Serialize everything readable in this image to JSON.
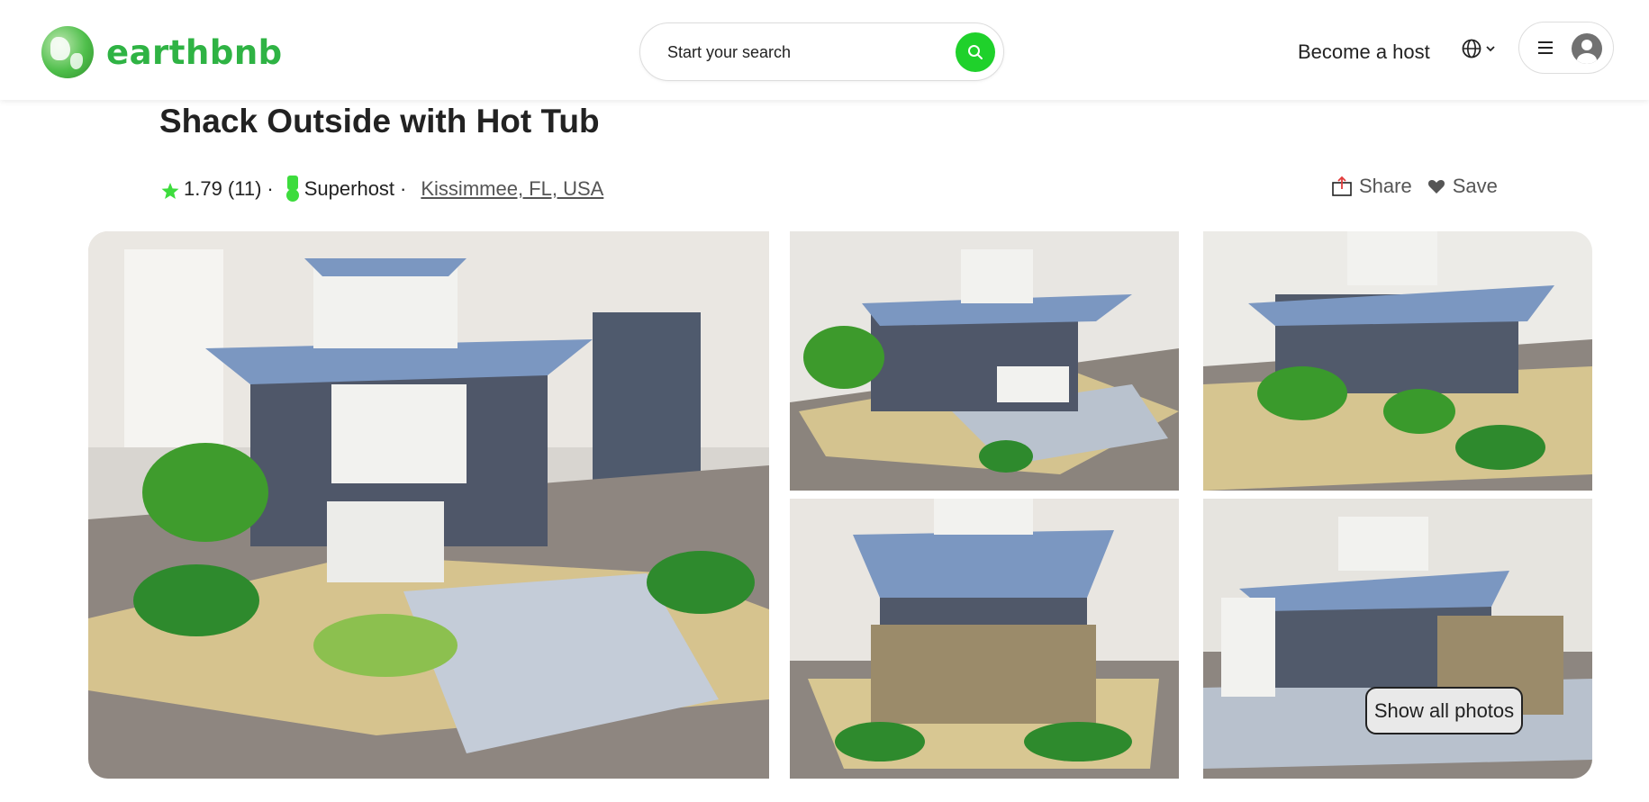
{
  "header": {
    "logo_text": "earthbnb",
    "search_placeholder": "Start your search",
    "become_host": "Become a host",
    "globe_icon": "globe-icon",
    "menu_icon": "hamburger-menu-icon",
    "avatar_icon": "user-avatar-icon"
  },
  "listing": {
    "title": "Shack Outside with Hot Tub",
    "rating": "1.79 (11)",
    "rating_separator": "·",
    "superhost": "Superhost",
    "superhost_separator": "·",
    "location": "Kissimmee, FL, USA",
    "share_label": "Share",
    "save_label": "Save"
  },
  "gallery": {
    "show_all_label": "Show all photos",
    "photos": [
      "lego-house-front-view",
      "lego-house-garage-view",
      "lego-house-rear-view",
      "lego-house-back-deck-view",
      "lego-house-side-view"
    ]
  },
  "colors": {
    "brand_green": "#2fb344",
    "search_green": "#1fd12b",
    "star_green": "#3ddc3d"
  }
}
